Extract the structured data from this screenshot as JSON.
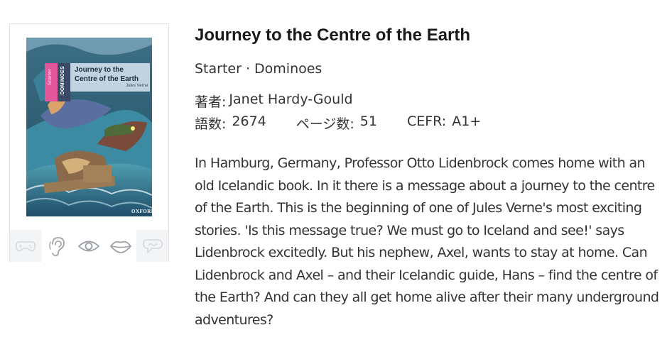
{
  "book": {
    "title": "Journey to the Centre of the Earth",
    "series_line": "Starter · Dominoes",
    "author_label": "著者:",
    "author": "Janet Hardy-Gould",
    "word_count_label": "語数:",
    "word_count": "2674",
    "pages_label": "ページ数:",
    "pages": "51",
    "cefr_label": "CEFR:",
    "cefr": "A1+",
    "description": "In Hamburg, Germany, Professor Otto Lidenbrock comes home with an old Icelandic book. In it there is a message about a journey to the centre of the Earth. This is the beginning of one of Jules Verne's most exciting stories. 'Is this message true? We must go to Iceland and see!' says Lidenbrock excitedly. But his nephew, Axel, wants to stay at home. Can Lidenbrock and Axel – and their Icelandic guide, Hans – find the centre of the Earth? And can they all get home alive after their many underground adventures?"
  },
  "cover": {
    "title": "Journey to the Centre of the Earth",
    "author": "Jules Verne",
    "level": "Starter",
    "series": "DOMINOES",
    "publisher": "OXFORD"
  },
  "skills": [
    {
      "icon": "gamepad-icon",
      "active": false
    },
    {
      "icon": "ear-icon",
      "active": true
    },
    {
      "icon": "eye-icon",
      "active": true
    },
    {
      "icon": "lips-icon",
      "active": true
    },
    {
      "icon": "speech-bubble-icon",
      "active": false
    }
  ],
  "colors": {
    "active_icon": "#9aa0a6",
    "inactive_icon": "#d8dbdf",
    "skills_bg": "#f3f4f5"
  }
}
